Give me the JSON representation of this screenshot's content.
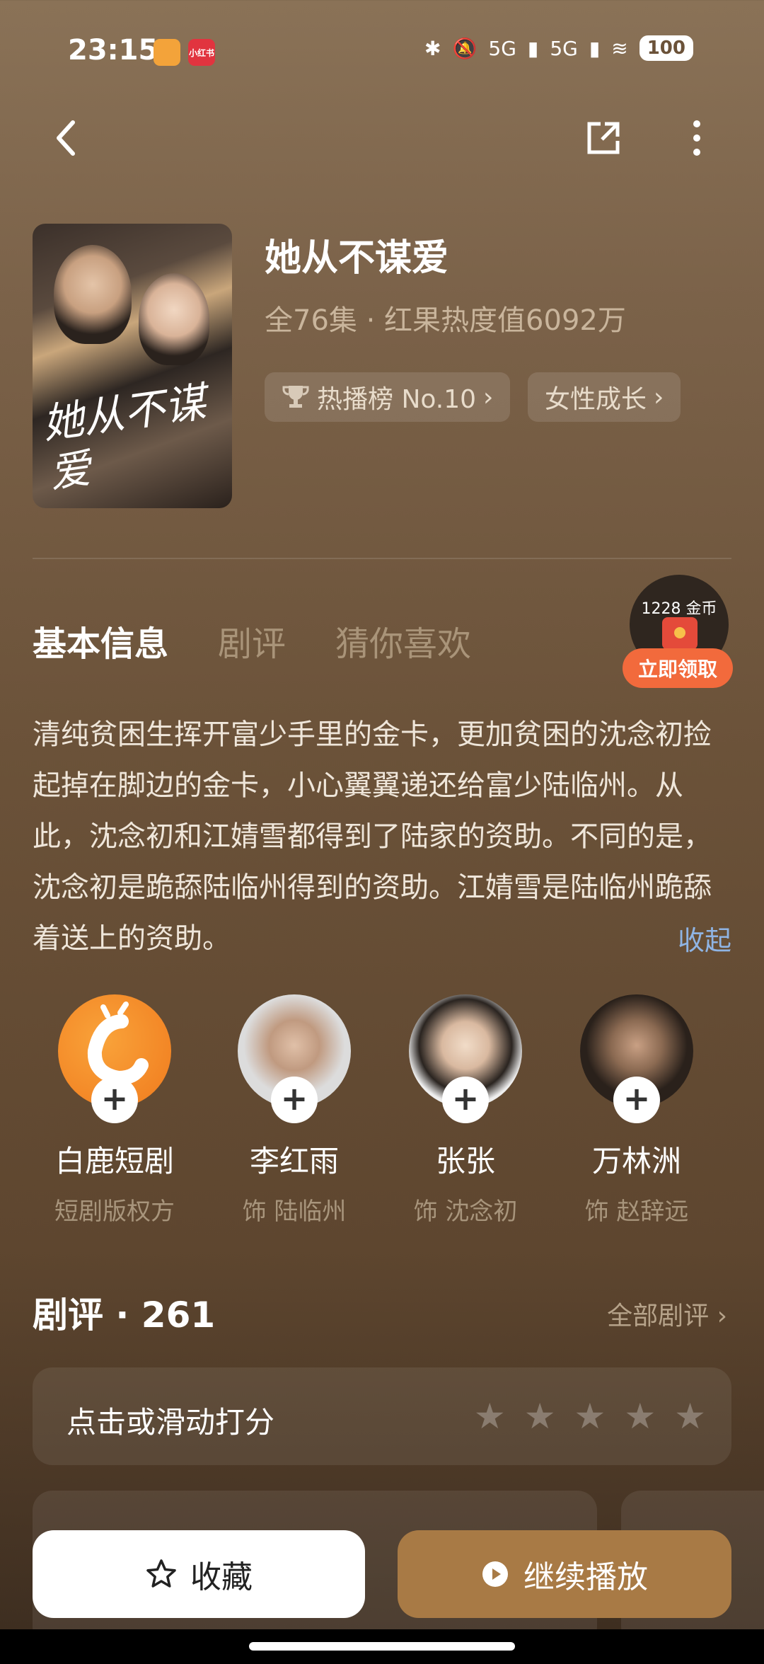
{
  "status": {
    "time": "23:15",
    "badge_red": "小红书",
    "network1": "5G",
    "network2": "5G",
    "battery": "100"
  },
  "drama": {
    "title": "她从不谋爱",
    "meta": "全76集 · 红果热度值6092万",
    "poster_title": "她从不谋爱",
    "tags": [
      {
        "label": "热播榜 No.10",
        "icon": "trophy-icon"
      },
      {
        "label": "女性成长",
        "icon": ""
      }
    ]
  },
  "tabs": [
    "基本信息",
    "剧评",
    "猜你喜欢"
  ],
  "coins": {
    "amount": "1228 金币",
    "button": "立即领取"
  },
  "description": "清纯贫困生挥开富少手里的金卡，更加贫困的沈念初捡起掉在脚边的金卡，小心翼翼递还给富少陆临州。从此，沈念初和江婧雪都得到了陆家的资助。不同的是，沈念初是跪舔陆临州得到的资助。江婧雪是陆临州跪舔着送上的资助。",
  "collapse_label": "收起",
  "cast": [
    {
      "name": "白鹿短剧",
      "role": "短剧版权方"
    },
    {
      "name": "李红雨",
      "role": "饰 陆临州"
    },
    {
      "name": "张张",
      "role": "饰 沈念初"
    },
    {
      "name": "万林洲",
      "role": "饰 赵辞远"
    }
  ],
  "reviews": {
    "heading": "剧评 · 261",
    "all_label": "全部剧评 ›",
    "rate_label": "点击或滑动打分",
    "rating": 0
  },
  "actions": {
    "collect": "收藏",
    "play": "继续播放"
  },
  "colors": {
    "play_button": "#a87a45",
    "coin_button": "#f26a3c",
    "link": "#8fb4e4"
  }
}
